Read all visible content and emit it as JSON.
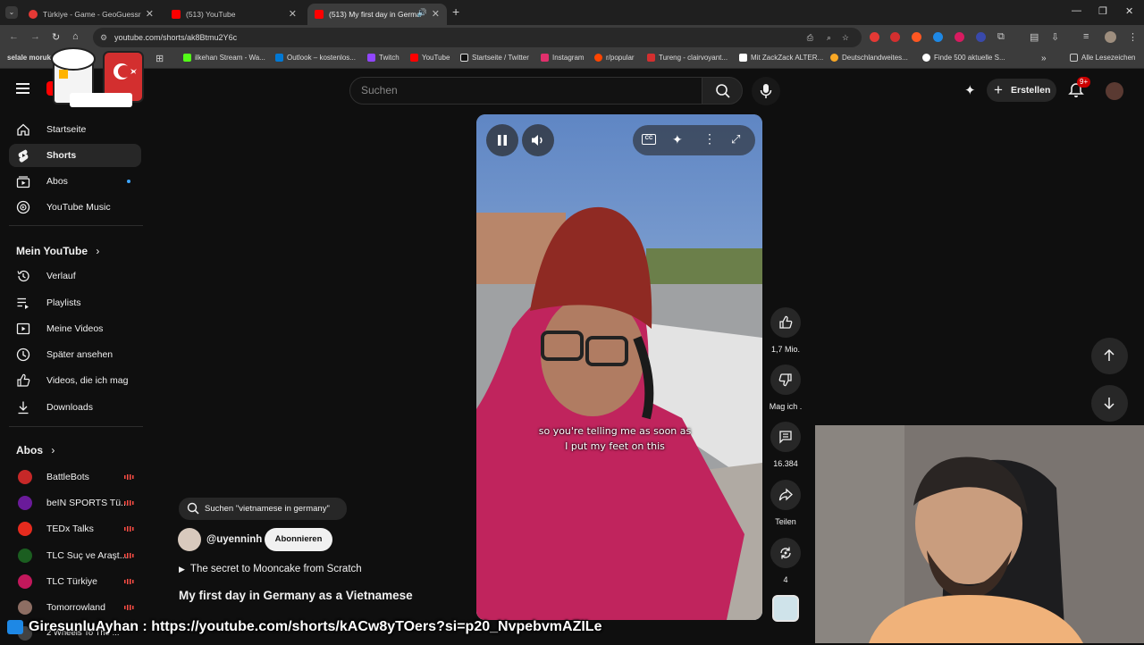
{
  "browser": {
    "tabs": [
      {
        "title": "Türkiye - Game - GeoGuessr",
        "color": "#e53935"
      },
      {
        "title": "(513) YouTube",
        "color": "#ff0000"
      },
      {
        "title": "(513) My first day in Germa",
        "color": "#ff0000"
      }
    ],
    "new_tab": "+",
    "url": "youtube.com/shorts/ak8Btmu2Y6c",
    "bookmarks": [
      {
        "label": "selale moruk",
        "color": "#ffb300"
      },
      {
        "label": "ilkehan Stream - Wa...",
        "color": "#53fc18"
      },
      {
        "label": "Outlook – kostenlos...",
        "color": "#0078d4"
      },
      {
        "label": "Twitch",
        "color": "#9146ff"
      },
      {
        "label": "YouTube",
        "color": "#ff0000"
      },
      {
        "label": "Startseite / Twitter",
        "color": "#ffffff"
      },
      {
        "label": "Instagram",
        "color": "#e1306c"
      },
      {
        "label": "r/popular",
        "color": "#ff4500"
      },
      {
        "label": "Tureng - clairvoyant...",
        "color": "#d32f2f"
      },
      {
        "label": "Mit ZackZack ALTER...",
        "color": "#ffffff"
      },
      {
        "label": "Deutschlandweites...",
        "color": "#f9a825"
      },
      {
        "label": "Finde 500 aktuelle S...",
        "color": "#ffffff"
      }
    ],
    "more": "»",
    "all_bookmarks": "Alle Lesezeichen"
  },
  "header": {
    "search_placeholder": "Suchen",
    "create_label": "Erstellen",
    "notif_badge": "9+"
  },
  "sidebar": {
    "main": [
      {
        "label": "Startseite",
        "icon": "home-icon"
      },
      {
        "label": "Shorts",
        "icon": "shorts-icon"
      },
      {
        "label": "Abos",
        "icon": "subscriptions-icon"
      },
      {
        "label": "YouTube Music",
        "icon": "music-icon"
      }
    ],
    "you_heading": "Mein YouTube",
    "you": [
      {
        "label": "Verlauf",
        "icon": "history-icon"
      },
      {
        "label": "Playlists",
        "icon": "playlists-icon"
      },
      {
        "label": "Meine Videos",
        "icon": "my-videos-icon"
      },
      {
        "label": "Später ansehen",
        "icon": "watch-later-icon"
      },
      {
        "label": "Videos, die ich mag",
        "icon": "liked-icon"
      },
      {
        "label": "Downloads",
        "icon": "downloads-icon"
      }
    ],
    "subs_heading": "Abos",
    "subs": [
      {
        "label": "BattleBots",
        "color": "#c62828"
      },
      {
        "label": "beIN SPORTS Tü...",
        "color": "#6a1b9a"
      },
      {
        "label": "TEDx Talks",
        "color": "#e62b1e"
      },
      {
        "label": "TLC Suç ve Araşt...",
        "color": "#1b5e20"
      },
      {
        "label": "TLC Türkiye",
        "color": "#c2185b"
      },
      {
        "label": "Tomorrowland",
        "color": "#8d6e63"
      },
      {
        "label": "2 Wheels To The ...",
        "color": "#424242"
      }
    ]
  },
  "short": {
    "caption_line1": "so you're telling me as soon as",
    "caption_line2": "I put my feet on this",
    "likes": "1,7 Mio.",
    "dislike_label": "Mag ich .",
    "comments": "16.384",
    "share_label": "Teilen",
    "remix_count": "4",
    "suggestion": "Suchen \"vietnamese in germany\"",
    "channel": "@uyenninh",
    "subscribe": "Abonnieren",
    "music": "The secret to Mooncake from Scratch",
    "title": "My first day in Germany as a Vietnamese"
  },
  "stream": {
    "chat_user": "GiresunluAyhan",
    "chat_message": " : https://youtube.com/shorts/kACw8yTOers?si=p20_NvpebvmAZILe"
  }
}
